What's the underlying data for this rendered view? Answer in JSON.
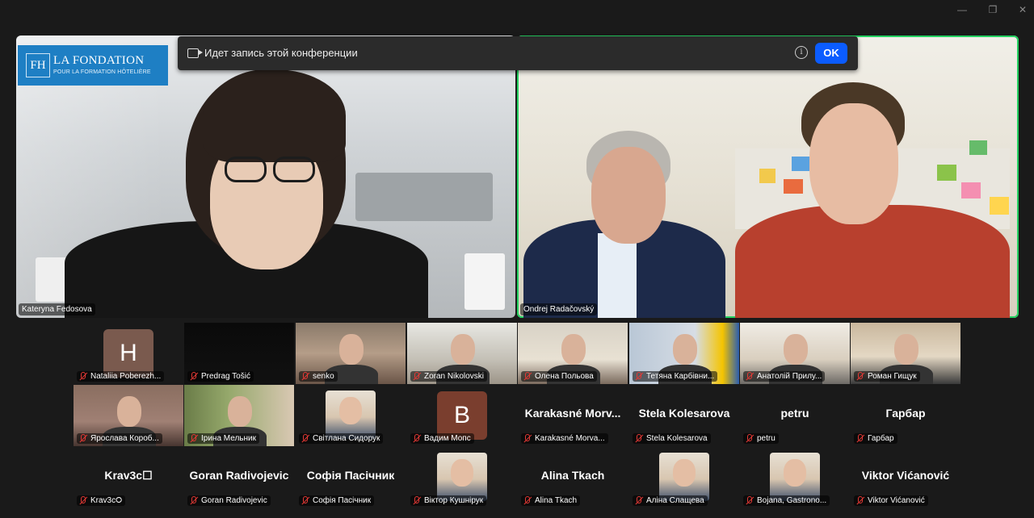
{
  "window": {
    "minimize_icon": "minimize-icon",
    "restore_icon": "restore-icon",
    "close_icon": "close-icon"
  },
  "banner": {
    "text": "Идет запись этой конференции",
    "ok_label": "OK",
    "accent": "#0b5cff"
  },
  "logo": {
    "mark": "FH",
    "line1": "LA FONDATION",
    "line2": "POUR LA FORMATION HÔTELIÈRE"
  },
  "main_left": {
    "name": "Kateryna Fedosova"
  },
  "main_right": {
    "name": "Ondrej Radačovský",
    "active_color": "#23d160"
  },
  "participants": [
    {
      "name": "Nataliia Poberezh...",
      "avatar": "H",
      "avatar_color": "#7a5a4e",
      "kind": "letter"
    },
    {
      "name": "Predrag Tošić",
      "kind": "video-dark"
    },
    {
      "name": "senko",
      "kind": "video"
    },
    {
      "name": "Zoran Nikolovski",
      "kind": "video"
    },
    {
      "name": "Олена Польова",
      "kind": "video"
    },
    {
      "name": "Тетяна Карбівни...",
      "kind": "video"
    },
    {
      "name": "Анатолій Прилу...",
      "kind": "video"
    },
    {
      "name": "Роман Гищук",
      "kind": "video"
    },
    {
      "name": "Ярослава Короб...",
      "kind": "video"
    },
    {
      "name": "Ірина Мельник",
      "kind": "video"
    },
    {
      "name": "Світлана Сидорук",
      "kind": "photo"
    },
    {
      "name": "Вадим Мопс",
      "avatar": "B",
      "avatar_color": "#7a3e2e",
      "kind": "letter"
    },
    {
      "name": "Karakasné Morva...",
      "big": "Karakasné Morv...",
      "kind": "name"
    },
    {
      "name": "Stela Kolesarova",
      "big": "Stela Kolesarova",
      "kind": "name"
    },
    {
      "name": "petru",
      "big": "petru",
      "kind": "name"
    },
    {
      "name": "Гарбар",
      "big": "Гарбар",
      "kind": "name"
    },
    {
      "name": "Krav3c⭘",
      "big": "Krav3c☐",
      "kind": "name"
    },
    {
      "name": "Goran Radivojevic",
      "big": "Goran Radivojevic",
      "kind": "name"
    },
    {
      "name": "Софія Пасічник",
      "big": "Софія Пасічник",
      "kind": "name"
    },
    {
      "name": "Віктор Кушнірук",
      "kind": "photo"
    },
    {
      "name": "Alina Tkach",
      "big": "Alina Tkach",
      "kind": "name"
    },
    {
      "name": "Аліна Слащева",
      "kind": "photo"
    },
    {
      "name": "Bojana, Gastrono...",
      "kind": "photo"
    },
    {
      "name": "Viktor Vićanović",
      "big": "Viktor Vićanović",
      "kind": "name"
    }
  ]
}
